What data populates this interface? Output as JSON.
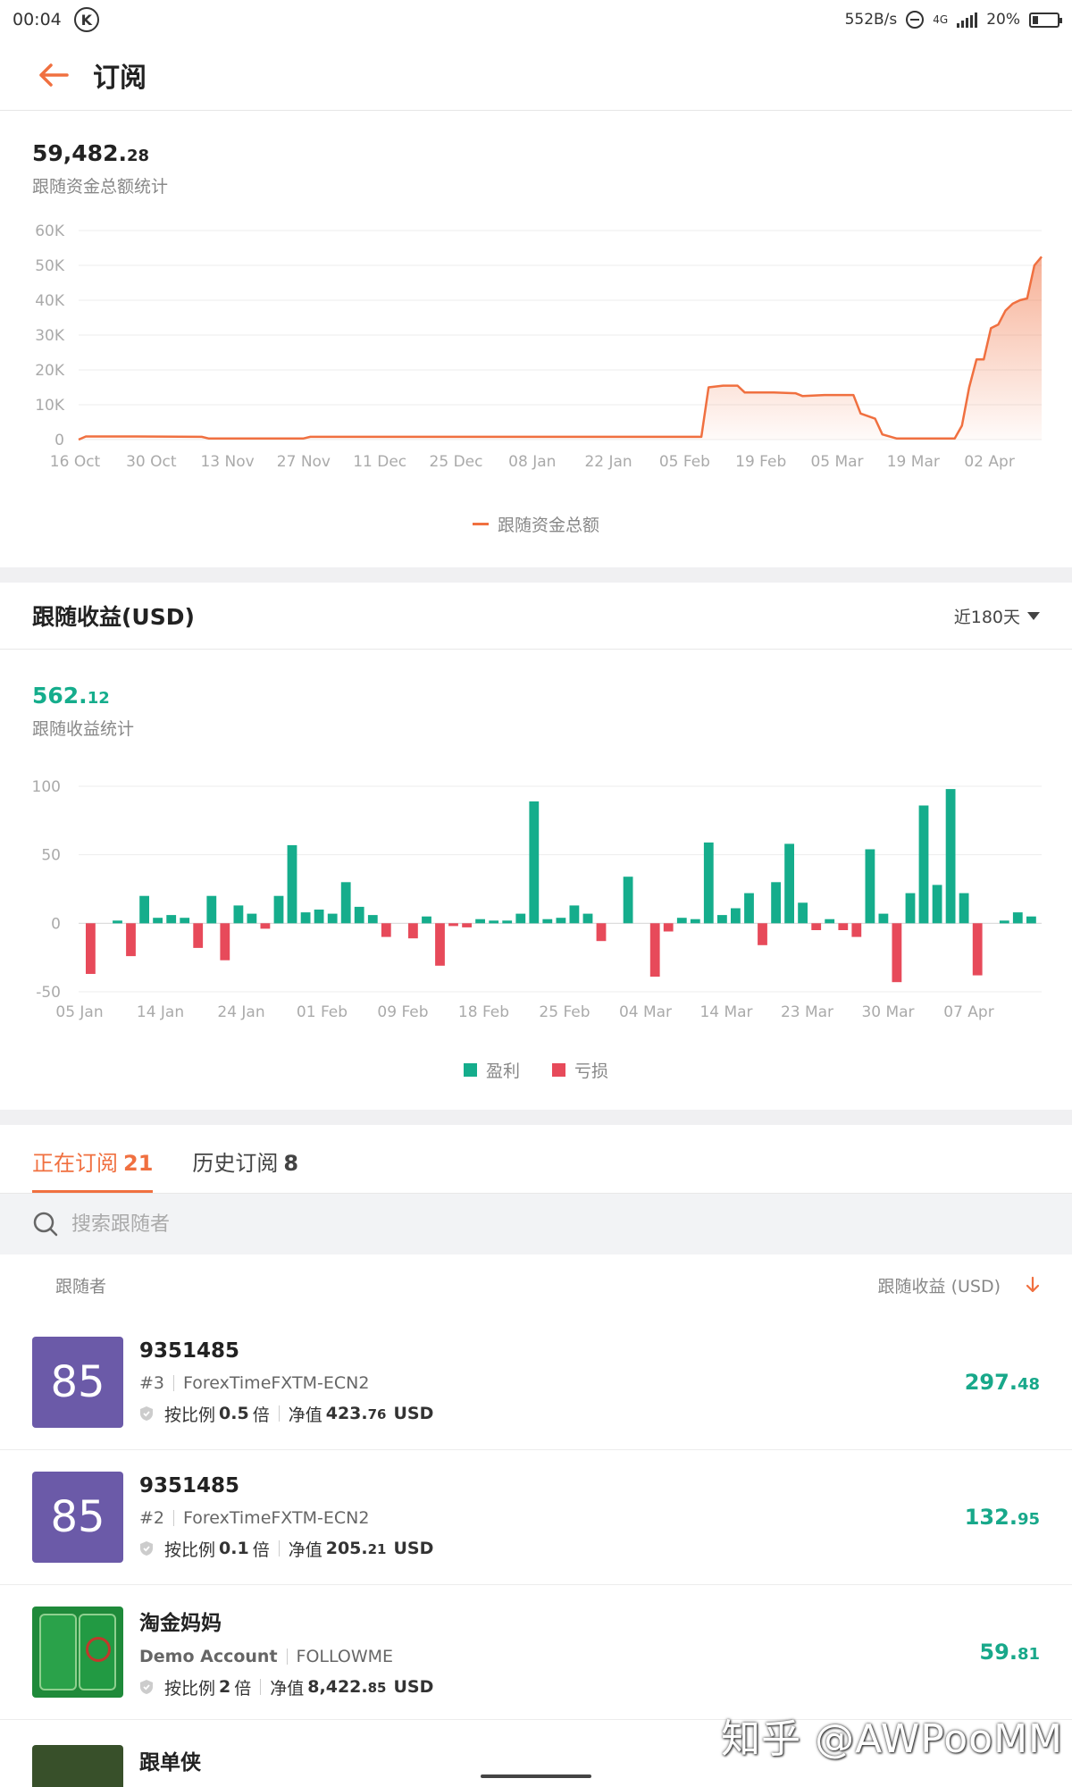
{
  "status_bar": {
    "time": "00:04",
    "network_speed": "552B/s",
    "network_type": "4G",
    "battery": "20%",
    "battery_fraction": 0.2
  },
  "header": {
    "title": "订阅"
  },
  "total_funds": {
    "value_int": "59,482.",
    "value_dec": "28",
    "subtitle": "跟随资金总额统计",
    "legend": "跟随资金总额",
    "chart_data": {
      "type": "area",
      "color": "#f07040",
      "yticks": [
        "60K",
        "50K",
        "40K",
        "30K",
        "20K",
        "10K",
        "0"
      ],
      "ylim": [
        0,
        60000
      ],
      "xtick_labels": [
        "16 Oct",
        "30 Oct",
        "13 Nov",
        "27 Nov",
        "11 Dec",
        "25 Dec",
        "08 Jan",
        "22 Jan",
        "05 Feb",
        "19 Feb",
        "05 Mar",
        "19 Mar",
        "02 Apr"
      ],
      "series": [
        {
          "name": "跟随资金总额",
          "values": [
            [
              0,
              0
            ],
            [
              1,
              900
            ],
            [
              8,
              900
            ],
            [
              17,
              800
            ],
            [
              18,
              300
            ],
            [
              31,
              300
            ],
            [
              32,
              800
            ],
            [
              85,
              800
            ],
            [
              86,
              800
            ],
            [
              87,
              15000
            ],
            [
              89,
              15500
            ],
            [
              91,
              15500
            ],
            [
              92,
              13500
            ],
            [
              96,
              13500
            ],
            [
              99,
              13300
            ],
            [
              100,
              12500
            ],
            [
              103,
              12800
            ],
            [
              107,
              12800
            ],
            [
              108,
              7500
            ],
            [
              110,
              6000
            ],
            [
              111,
              1500
            ],
            [
              113,
              300
            ],
            [
              121,
              300
            ],
            [
              122,
              4000
            ],
            [
              123,
              15000
            ],
            [
              124,
              23000
            ],
            [
              125,
              23000
            ],
            [
              126,
              32000
            ],
            [
              127,
              33000
            ],
            [
              128,
              37000
            ],
            [
              129,
              39000
            ],
            [
              130,
              40000
            ],
            [
              131,
              40500
            ],
            [
              132,
              50000
            ],
            [
              133,
              52500
            ]
          ]
        }
      ]
    }
  },
  "earnings": {
    "title": "跟随收益(USD)",
    "range_label": "近180天",
    "value_int": "562.",
    "value_dec": "12",
    "subtitle": "跟随收益统计",
    "legend_profit": "盈利",
    "legend_loss": "亏损",
    "color_profit": "#15ad8c",
    "color_loss": "#e74a5a",
    "chart_data": {
      "type": "bar",
      "yticks": [
        "100",
        "50",
        "0",
        "-50"
      ],
      "ylim": [
        -50,
        100
      ],
      "xtick_labels": [
        "05 Jan",
        "14 Jan",
        "24 Jan",
        "01 Feb",
        "09 Feb",
        "18 Feb",
        "25 Feb",
        "04 Mar",
        "14 Mar",
        "23 Mar",
        "30 Mar",
        "07 Apr"
      ],
      "values": [
        -37,
        0,
        2,
        -24,
        20,
        4,
        6,
        4,
        -18,
        20,
        -27,
        13,
        7,
        -4,
        20,
        57,
        8,
        10,
        7,
        30,
        12,
        6,
        -10,
        0,
        -11,
        5,
        -31,
        -2,
        -3,
        3,
        2,
        2,
        7,
        89,
        3,
        4,
        13,
        7,
        -13,
        0,
        34,
        0,
        -39,
        -6,
        4,
        3,
        59,
        6,
        11,
        22,
        -16,
        30,
        58,
        15,
        -5,
        3,
        -5,
        -10,
        54,
        7,
        -43,
        22,
        86,
        28,
        98,
        22,
        -38,
        0,
        2,
        8,
        5
      ]
    }
  },
  "subscriptions": {
    "tabs": [
      {
        "label": "正在订阅",
        "count": "21"
      },
      {
        "label": "历史订阅",
        "count": "8"
      }
    ],
    "search_placeholder": "搜索跟随者",
    "col_follower": "跟随者",
    "col_earnings": "跟随收益 (USD)",
    "rows": [
      {
        "avatar": "85",
        "name": "9351485",
        "rank": "#3",
        "broker": "ForexTimeFXTM-ECN2",
        "ratio_prefix": "按比例",
        "ratio": "0.5",
        "ratio_suffix": "倍",
        "equity_label": "净值",
        "equity_int": "423.",
        "equity_dec": "76",
        "currency": "USD",
        "profit_int": "297.",
        "profit_dec": "48"
      },
      {
        "avatar": "85",
        "name": "9351485",
        "rank": "#2",
        "broker": "ForexTimeFXTM-ECN2",
        "ratio_prefix": "按比例",
        "ratio": "0.1",
        "ratio_suffix": "倍",
        "equity_label": "净值",
        "equity_int": "205.",
        "equity_dec": "21",
        "currency": "USD",
        "profit_int": "132.",
        "profit_dec": "95"
      },
      {
        "avatar": "",
        "name": "淘金妈妈",
        "rank": "Demo Account",
        "broker": "FOLLOWME",
        "ratio_prefix": "按比例",
        "ratio": "2",
        "ratio_suffix": "倍",
        "equity_label": "净值",
        "equity_int": "8,422.",
        "equity_dec": "85",
        "currency": "USD",
        "profit_int": "59.",
        "profit_dec": "81"
      },
      {
        "avatar": "",
        "name": "跟单侠"
      }
    ]
  },
  "watermark": "知乎 @AWPooMM"
}
